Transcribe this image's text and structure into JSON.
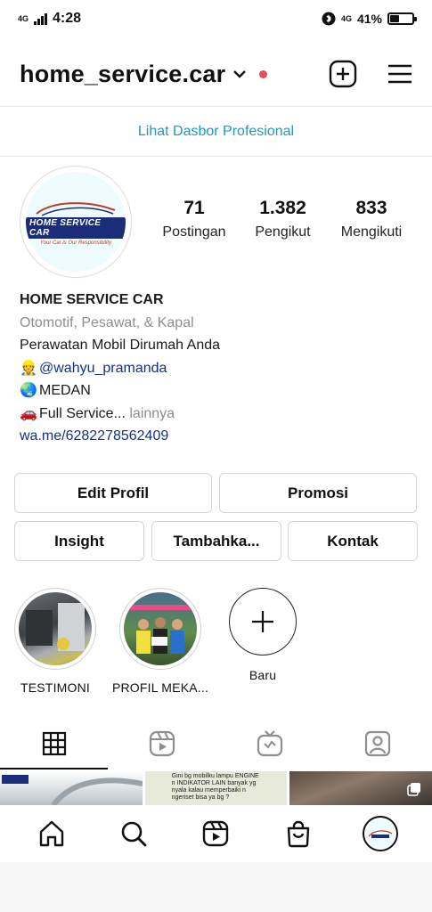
{
  "status_bar": {
    "network": "4G",
    "time": "4:28",
    "net_right": "4G",
    "battery_pct": "41%",
    "battery_level": 0.41
  },
  "header": {
    "username": "home_service.car",
    "chevron": "⌄",
    "add_icon": "plus-square-icon",
    "menu_icon": "hamburger-menu-icon"
  },
  "pro_dashboard": {
    "label": "Lihat Dasbor Profesional"
  },
  "profile": {
    "logo_text": "HOME SERVICE CAR",
    "logo_tagline": "Your Car is Our Responsibility",
    "stats": [
      {
        "num": "71",
        "label": "Postingan"
      },
      {
        "num": "1.382",
        "label": "Pengikut"
      },
      {
        "num": "833",
        "label": "Mengikuti"
      }
    ],
    "name": "HOME SERVICE CAR",
    "category": "Otomotif, Pesawat, & Kapal",
    "bio_line1": "Perawatan Mobil Dirumah Anda",
    "bio_mention_emoji": "👷",
    "bio_mention": "@wahyu_pramanda",
    "bio_location_emoji": "🌏",
    "bio_location": "MEDAN",
    "bio_service_emoji": "🚗",
    "bio_service": "Full Service",
    "bio_ellipsis": "...",
    "bio_more": "lainnya",
    "bio_link": "wa.me/6282278562409"
  },
  "buttons": {
    "edit_profile": "Edit Profil",
    "promote": "Promosi",
    "insight": "Insight",
    "add": "Tambahka...",
    "contact": "Kontak"
  },
  "highlights": [
    {
      "label": "TESTIMONI"
    },
    {
      "label": "PROFIL MEKA..."
    },
    {
      "label": "Baru"
    }
  ],
  "tabs": [
    {
      "icon": "grid-icon",
      "active": true
    },
    {
      "icon": "reels-icon",
      "active": false
    },
    {
      "icon": "igtv-icon",
      "active": false
    },
    {
      "icon": "tagged-icon",
      "active": false
    }
  ],
  "thumbs": [
    {
      "text": ""
    },
    {
      "text": "Gini bg mobilku lampu ENGINE n INDIKATOR LAIN banyak yg nyala kalau memperbaiki n ngeriset bisa ya bg ?"
    },
    {
      "text": ""
    }
  ],
  "bottom_nav": [
    {
      "icon": "home-icon"
    },
    {
      "icon": "search-icon"
    },
    {
      "icon": "reels-icon"
    },
    {
      "icon": "shop-icon"
    },
    {
      "icon": "profile-avatar-icon"
    }
  ]
}
